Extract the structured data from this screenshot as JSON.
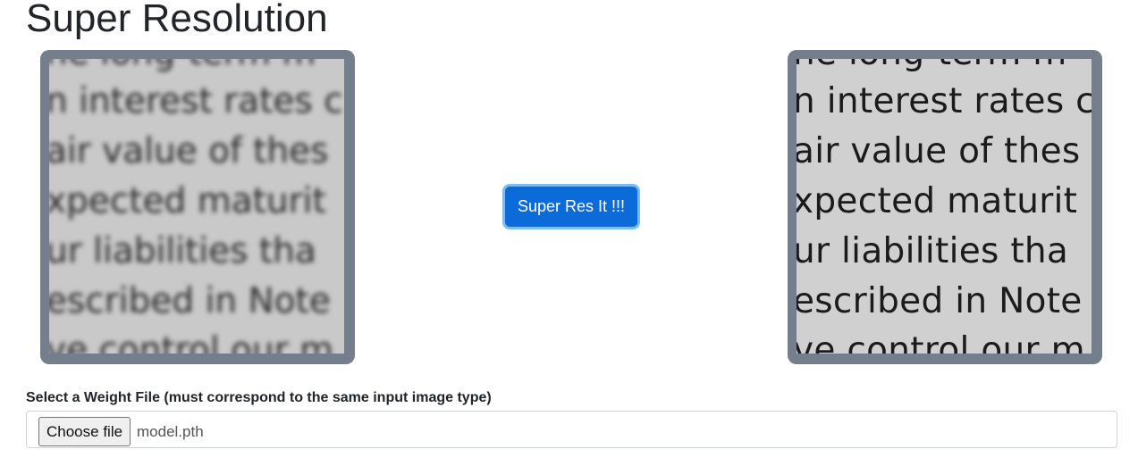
{
  "page": {
    "title": "Super Resolution"
  },
  "input_image": {
    "alt": "blurry low-resolution document text",
    "lines": [
      "he long-term m",
      "n interest rates c",
      "air value of thes",
      "xpected maturit",
      "ur liabilities tha",
      "escribed in Note",
      "ve control our m"
    ]
  },
  "output_image": {
    "alt": "sharpened super-resolved document text",
    "lines": [
      "he long-term m",
      "n interest rates c",
      "air value of thes",
      "xpected maturit",
      "ur liabilities tha",
      "escribed in Note",
      "ve control our m"
    ]
  },
  "actions": {
    "super_res_label": "Super Res It !!!"
  },
  "weight_field": {
    "label": "Select a Weight File (must correspond to the same input image type)",
    "choose_label": "Choose file",
    "file_name": "model.pth"
  },
  "colors": {
    "frame": "#757e8c",
    "button": "#0b6bd8",
    "button_ring": "#7cbcf4"
  }
}
